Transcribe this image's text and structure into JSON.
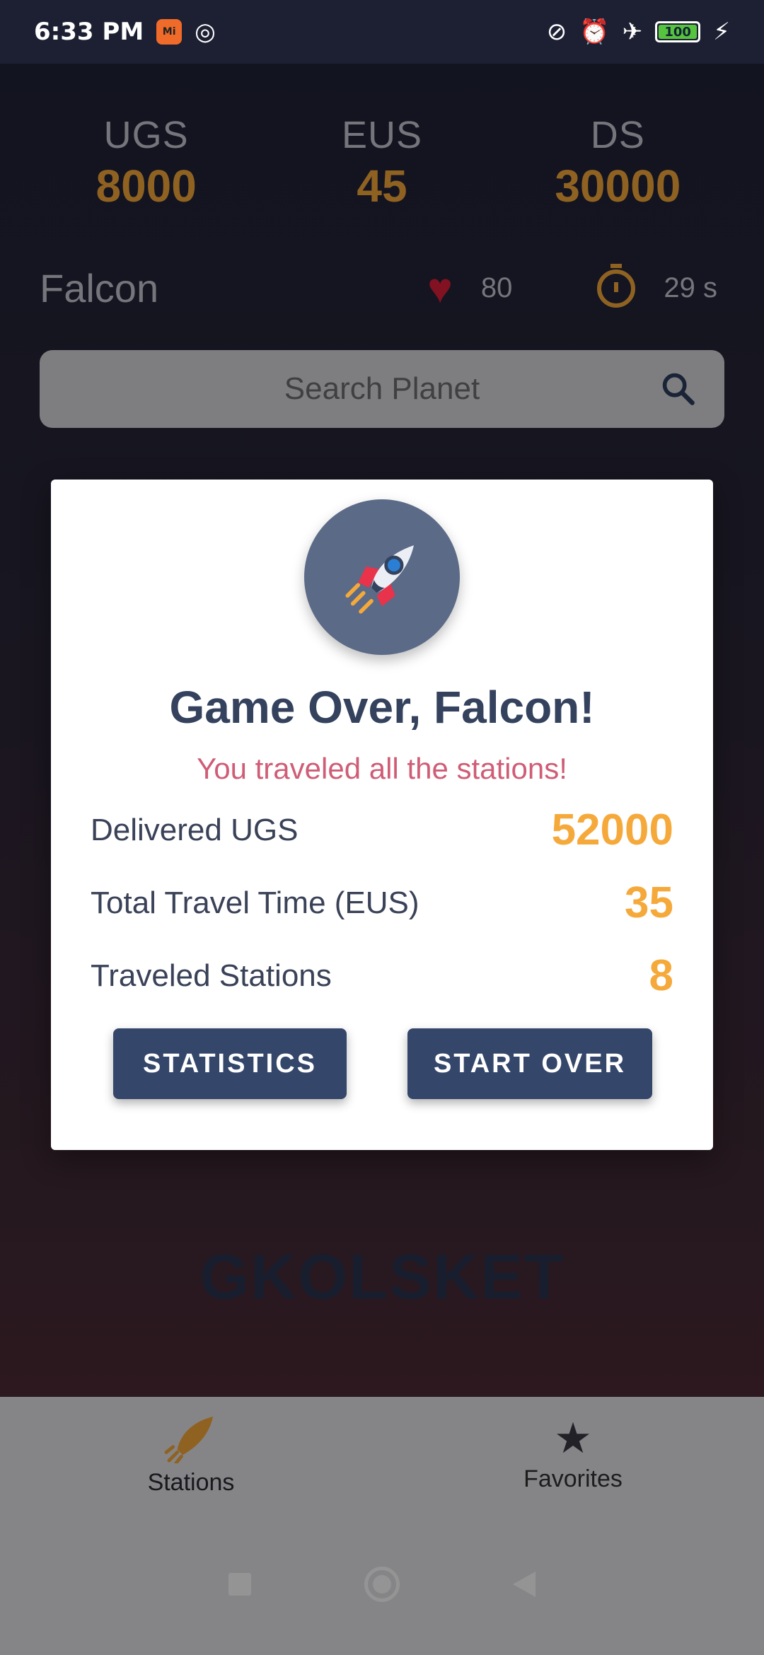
{
  "status_bar": {
    "time": "6:33 PM",
    "app_icon_text": "Mi",
    "battery": "100",
    "icons": [
      "notification-icon",
      "vibrate-off-icon",
      "alarm-icon",
      "airplane-icon",
      "battery-icon",
      "charging-icon"
    ]
  },
  "resources": [
    {
      "label": "UGS",
      "value": "8000"
    },
    {
      "label": "EUS",
      "value": "45"
    },
    {
      "label": "DS",
      "value": "30000"
    }
  ],
  "ship": {
    "name": "Falcon",
    "health": "80",
    "timer": "29 s"
  },
  "search": {
    "placeholder": "Search Planet"
  },
  "current_planet": "GKOLSKET",
  "dialog": {
    "title": "Game Over, Falcon!",
    "subtitle": "You traveled all the stations!",
    "stats": [
      {
        "label": "Delivered UGS",
        "value": "52000"
      },
      {
        "label": "Total Travel Time (EUS)",
        "value": "35"
      },
      {
        "label": "Traveled Stations",
        "value": "8"
      }
    ],
    "buttons": {
      "statistics": "STATISTICS",
      "start_over": "START OVER"
    }
  },
  "bottom_nav": [
    {
      "label": "Stations",
      "icon": "rocket-icon",
      "active": true
    },
    {
      "label": "Favorites",
      "icon": "star-icon",
      "active": false
    }
  ],
  "colors": {
    "accent": "#f6a93b",
    "dialog_title": "#34425e",
    "dialog_subtitle": "#cf5d76",
    "button": "#34466a"
  }
}
